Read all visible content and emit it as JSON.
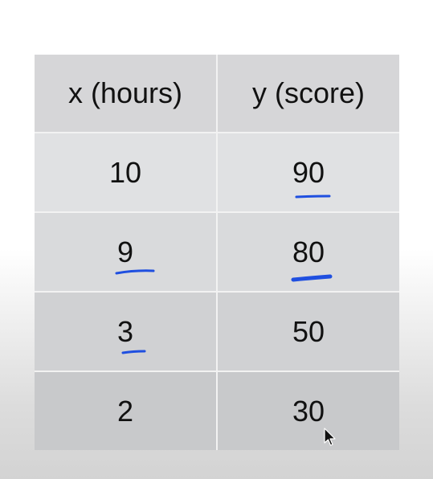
{
  "chart_data": {
    "type": "table",
    "columns": [
      "x (hours)",
      "y (score)"
    ],
    "rows": [
      [
        "10",
        "90"
      ],
      [
        "9",
        "80"
      ],
      [
        "3",
        "50"
      ],
      [
        "2",
        "30"
      ]
    ]
  },
  "annotation_color": "#1f4fe0",
  "icons": {
    "cursor": "mouse-pointer-icon"
  }
}
